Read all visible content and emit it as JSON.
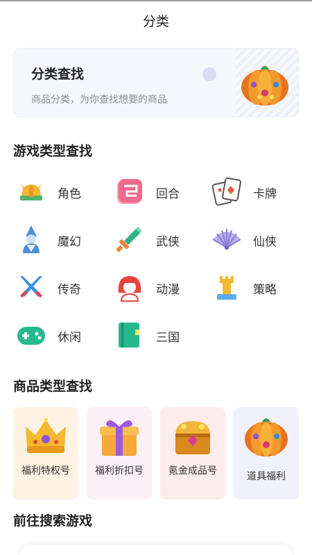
{
  "page": {
    "title": "分类"
  },
  "banner": {
    "title": "分类查找",
    "subtitle": "商品分类，为你查找想要的商品",
    "art_icon": "pumpkin-treasure-icon"
  },
  "game_types": {
    "title": "游戏类型查找",
    "items": [
      {
        "label": "角色",
        "icon": "viking-helmet-icon",
        "color": "#f2b632"
      },
      {
        "label": "回合",
        "icon": "turn-icon",
        "color": "#f06a8c"
      },
      {
        "label": "卡牌",
        "icon": "playing-cards-icon",
        "color": "#e85a3d"
      },
      {
        "label": "魔幻",
        "icon": "wizard-icon",
        "color": "#4a8fe0"
      },
      {
        "label": "武侠",
        "icon": "sword-icon",
        "color": "#2fb585"
      },
      {
        "label": "仙侠",
        "icon": "fan-icon",
        "color": "#8c7fd6"
      },
      {
        "label": "传奇",
        "icon": "crossed-swords-icon",
        "color": "#3f8ee8"
      },
      {
        "label": "动漫",
        "icon": "anime-girl-icon",
        "color": "#e8433f"
      },
      {
        "label": "策略",
        "icon": "chess-rook-icon",
        "color": "#f5b92e"
      },
      {
        "label": "休闲",
        "icon": "gamepad-icon",
        "color": "#27b88f"
      },
      {
        "label": "三国",
        "icon": "book-icon",
        "color": "#25b98e"
      }
    ]
  },
  "product_types": {
    "title": "商品类型查找",
    "items": [
      {
        "label": "福利特权号",
        "icon": "crown-icon",
        "bg": "#fef3e3"
      },
      {
        "label": "福利折扣号",
        "icon": "gift-box-icon",
        "bg": "#fdf0f7"
      },
      {
        "label": "氪金成品号",
        "icon": "treasure-chest-icon",
        "bg": "#fdecec"
      },
      {
        "label": "道具福利",
        "icon": "pumpkin-treasure-icon",
        "bg": "#f1f1fb"
      }
    ]
  },
  "search_section": {
    "title": "前往搜索游戏"
  }
}
